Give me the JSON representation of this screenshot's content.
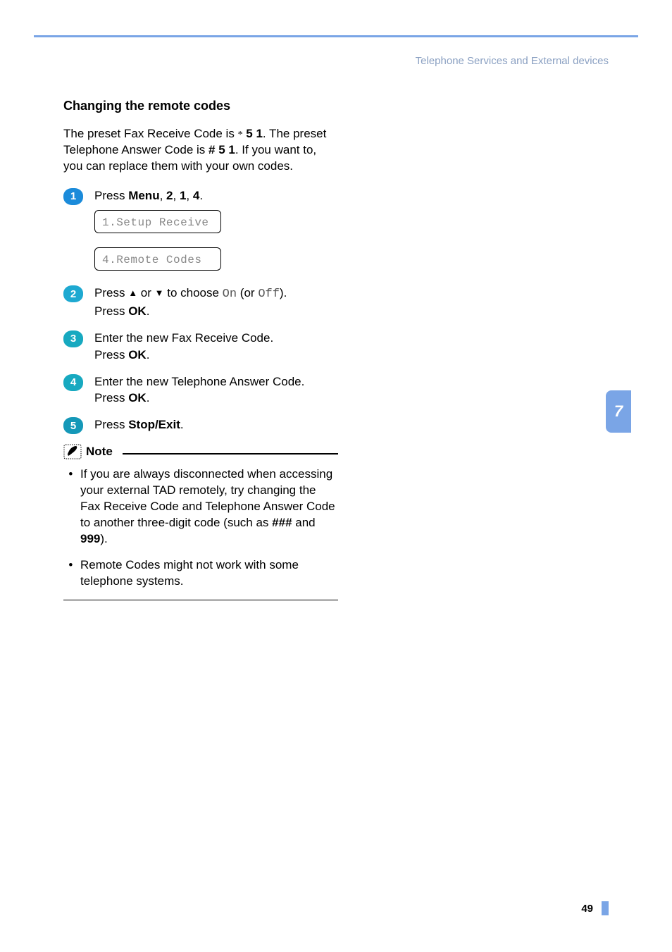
{
  "header": {
    "section_label": "Telephone Services and External devices"
  },
  "section_title": "Changing the remote codes",
  "intro": {
    "pre": "The preset Fax Receive Code is ",
    "star": "*",
    "code1": " 5 1",
    "mid": ". The preset Telephone Answer Code is ",
    "code2": "# 5 1",
    "post": ". If you want to, you can replace them with your own codes."
  },
  "steps": [
    {
      "num": "1",
      "parts": {
        "p1": "Press ",
        "b1": "Menu",
        "p2": ", ",
        "b2": "2",
        "p3": ", ",
        "b3": "1",
        "p4": ", ",
        "b4": "4",
        "p5": "."
      },
      "lcds": [
        "1.Setup Receive",
        "4.Remote Codes"
      ]
    },
    {
      "num": "2",
      "parts": {
        "p1": "Press ",
        "arrow_up": "a",
        "p2": " or ",
        "arrow_down": "b",
        "p3": " to choose ",
        "m1": "On",
        "p4": " (or ",
        "m2": "Off",
        "p5": ").",
        "line2a": "Press ",
        "line2b": "OK",
        "line2c": "."
      }
    },
    {
      "num": "3",
      "parts": {
        "line1": "Enter the new Fax Receive Code.",
        "line2a": "Press ",
        "line2b": "OK",
        "line2c": "."
      }
    },
    {
      "num": "4",
      "parts": {
        "line1": "Enter the new Telephone Answer Code.",
        "line2a": "Press ",
        "line2b": "OK",
        "line2c": "."
      }
    },
    {
      "num": "5",
      "parts": {
        "p1": "Press ",
        "b1": "Stop/Exit",
        "p2": "."
      }
    }
  ],
  "note": {
    "label": "Note",
    "items": [
      {
        "t1": "If you are always disconnected when accessing your external TAD remotely, try changing the Fax Receive Code and Telephone Answer Code to another three-digit code (such as ",
        "b1": "###",
        "t2": " and ",
        "b2": "999",
        "t3": ")."
      },
      {
        "t1": "Remote Codes might not work with some telephone systems."
      }
    ]
  },
  "tab": "7",
  "page_number": "49"
}
